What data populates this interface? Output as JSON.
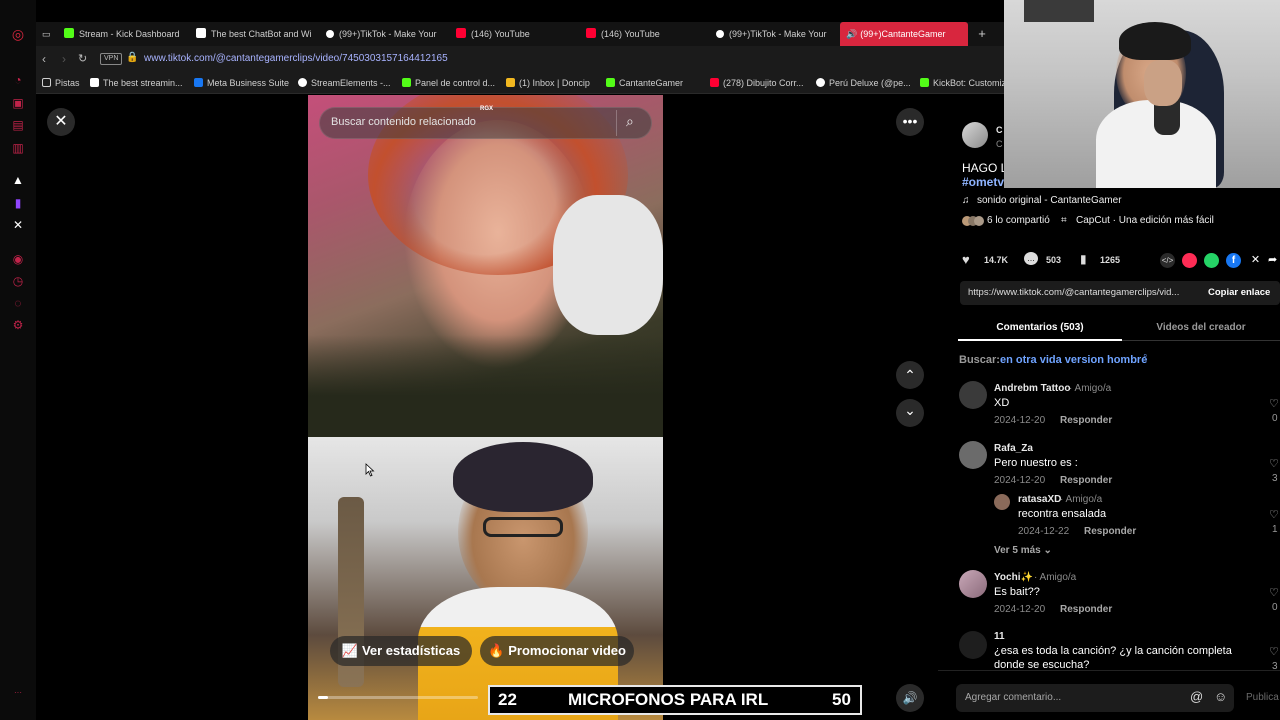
{
  "browser": {
    "tabs": [
      {
        "label": "Stream - Kick Dashboard",
        "color": "#53fc18"
      },
      {
        "label": "The best ChatBot and Wi",
        "color": "#ffffff"
      },
      {
        "label": "(99+)TikTok - Make Your",
        "color": "#ffffff"
      },
      {
        "label": "(146) YouTube",
        "color": "#ff0033"
      },
      {
        "label": "(146) YouTube",
        "color": "#ff0033"
      },
      {
        "label": "(99+)TikTok - Make Your",
        "color": "#ffffff"
      },
      {
        "label": "(99+)CantanteGamer",
        "color": "#ffffff"
      }
    ],
    "new_tab": "+",
    "vpn": "VPN",
    "url": "www.tiktok.com/@cantantegamerclips/video/7450303157164412165",
    "bookmarks": [
      {
        "label": "Pistas",
        "color": "#cfcfcf"
      },
      {
        "label": "The best streamin...",
        "color": "#ffffff"
      },
      {
        "label": "Meta Business Suite",
        "color": "#1877f2"
      },
      {
        "label": "StreamElements -...",
        "color": "#ffffff"
      },
      {
        "label": "Panel de control d...",
        "color": "#53fc18"
      },
      {
        "label": "(1) Inbox | Doncip",
        "color": "#f2b820"
      },
      {
        "label": "CantanteGamer",
        "color": "#53fc18"
      },
      {
        "label": "(278) Dibujito Corr...",
        "color": "#ff0033"
      },
      {
        "label": "Perú Deluxe (@pe...",
        "color": "#ffffff"
      },
      {
        "label": "KickBot: Customiz",
        "color": "#53fc18"
      }
    ]
  },
  "video": {
    "search_placeholder": "Buscar contenido relacionado",
    "watermark": "RGX",
    "stats_button": "Ver estadísticas",
    "promote_button": "Promocionar video",
    "progress": 0.06
  },
  "overlay": {
    "left_number": "22",
    "title": "MICROFONOS PARA IRL",
    "right_number": "50"
  },
  "post": {
    "author_initial": "C",
    "author_initial_2": "C",
    "caption_partial": "HAGO LL",
    "hashtag": "#ometv",
    "sound": "sonido original - CantanteGamer",
    "shared": "6 lo compartió",
    "capcut": "CapCut · Una edición más fácil",
    "likes": "14.7K",
    "comments": "503",
    "saves": "1265",
    "link": "https://www.tiktok.com/@cantantegamerclips/vid...",
    "copy_link": "Copiar enlace",
    "tab_comments": "Comentarios (503)",
    "tab_creator": "Videos del creador",
    "search_prefix": "Buscar:",
    "search_query": "en otra vida version hombre"
  },
  "comments": [
    {
      "name": "Andrebm Tattoo",
      "meta": "· Amigo/a",
      "text": "XD",
      "date": "2024-12-20",
      "reply": "Responder",
      "likes": "0"
    },
    {
      "name": "Rafa_Za",
      "meta": "",
      "text": "Pero nuestro es :",
      "date": "2024-12-20",
      "reply": "Responder",
      "likes": "3"
    },
    {
      "name": "ratasaXD",
      "meta": "· Amigo/a",
      "text": "recontra ensalada",
      "date": "2024-12-22",
      "reply": "Responder",
      "likes": "1"
    },
    {
      "name": "Yochi✨",
      "meta": "· Amigo/a",
      "text": "Es bait??",
      "date": "2024-12-20",
      "reply": "Responder",
      "likes": "0"
    },
    {
      "name": "11",
      "meta": "",
      "text": "¿esa es toda la canción? ¿y la canción completa",
      "text2": "donde se escucha?",
      "likes": "3"
    }
  ],
  "see_more": "Ver 5 más",
  "add_comment_placeholder": "Agregar comentario...",
  "publish": "Publica"
}
